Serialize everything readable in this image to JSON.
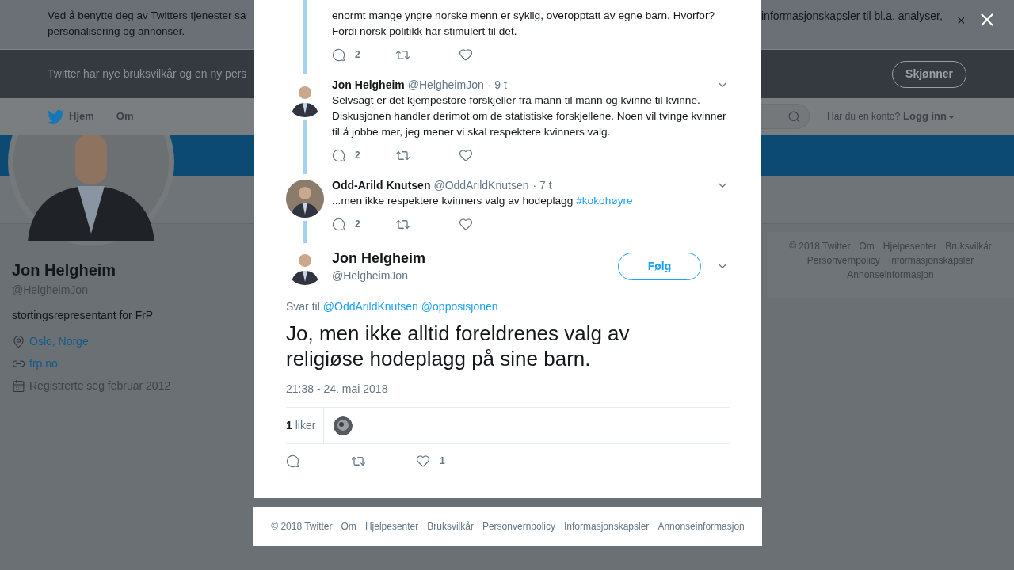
{
  "cookie_banner": {
    "text_left": [
      "Ved å benytte deg av Twitters tjenester sa",
      "personalisering og annonser."
    ],
    "text_right": "informasjonskapsler til bl.a. analyser,",
    "close": "×"
  },
  "terms_banner": {
    "text": "Twitter har nye bruksvilkår og en ny pers",
    "button": "Skjønner"
  },
  "nav": {
    "items": [
      {
        "label": "Hjem",
        "kind": "logo"
      },
      {
        "label": "Om",
        "kind": "plain"
      }
    ],
    "account_prompt": "Har du en konto?",
    "login": "Logg inn"
  },
  "profile": {
    "name": "Jon Helgheim",
    "handle": "@HelgheimJon",
    "bio": "stortingsrepresentant for FrP",
    "details": [
      {
        "kind": "location",
        "text": "Oslo, Norge"
      },
      {
        "kind": "link",
        "text": "frp.no"
      },
      {
        "kind": "joined",
        "text": "Registrerte seg februar 2012"
      }
    ]
  },
  "side_footer": {
    "links": [
      "© 2018 Twitter",
      "Om",
      "Hjelpesenter",
      "Bruksvilkår",
      "Personvernpolicy",
      "Informasjonskapsler",
      "Annonseinformasjon"
    ]
  },
  "thread": [
    {
      "kind": "partial",
      "text": "enormt mange yngre norske menn er syklig, overopptatt av egne barn. Hvorfor? Fordi norsk politikk har stimulert til det.",
      "replies": "2"
    },
    {
      "kind": "full",
      "name": "Jon Helgheim",
      "handle": "@HelgheimJon",
      "time": "· 9 t",
      "text": "Selvsagt er det kjempestore forskjeller fra mann til mann og kvinne til kvinne. Diskusjonen handler derimot om de statistiske forskjellene. Noen vil tvinge kvinner til å jobbe mer, jeg mener vi skal respektere kvinners valg.",
      "replies": "2"
    },
    {
      "kind": "full",
      "name": "Odd-Arild Knutsen",
      "handle": "@OddArildKnutsen",
      "time": "· 7 t",
      "text": "...men ikke respektere kvinners valg av hodeplagg",
      "hashtag": "#kokohøyre",
      "replies": "2"
    }
  ],
  "main_tweet": {
    "name": "Jon Helgheim",
    "handle": "@HelgheimJon",
    "follow": "Følg",
    "reply_label": "Svar til",
    "mentions": [
      "@OddArildKnutsen",
      "@opposisjonen"
    ],
    "text": "Jo, men ikke alltid foreldrenes valg av religiøse hodeplagg på sine barn.",
    "timestamp": "21:38 - 24. mai 2018",
    "likes_count": "1",
    "likes_label": "liker",
    "like_action_count": "1"
  },
  "modal_footer": {
    "links": [
      "© 2018 Twitter",
      "Om",
      "Hjelpesenter",
      "Bruksvilkår",
      "Personvernpolicy",
      "Informasjonskapsler",
      "Annonseinformasjon"
    ]
  }
}
